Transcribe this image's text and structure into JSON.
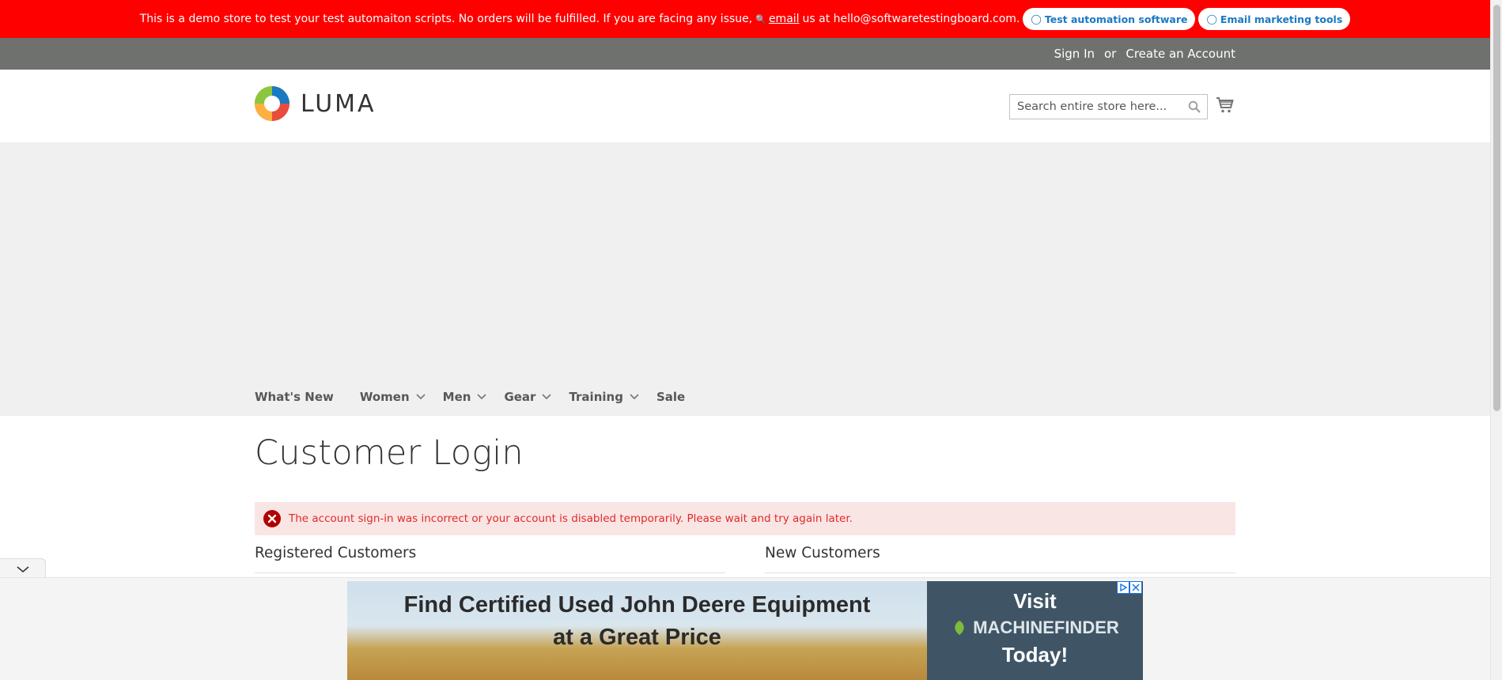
{
  "demo_banner": {
    "text": "This is a demo store to test your test automaiton scripts. No orders will be fulfilled. If you are facing any issue,",
    "email_link": "email",
    "text_after": "us at hello@softwaretestingboard.com.",
    "pill_1": "Test automation software",
    "pill_2": "Email marketing tools"
  },
  "panel": {
    "sign_in": "Sign In",
    "or": "or",
    "create_account": "Create an Account"
  },
  "header": {
    "logo_text": "LUMA",
    "search_placeholder": "Search entire store here..."
  },
  "nav": {
    "items": [
      {
        "label": "What's New"
      },
      {
        "label": "Women"
      },
      {
        "label": "Men"
      },
      {
        "label": "Gear"
      },
      {
        "label": "Training"
      },
      {
        "label": "Sale"
      }
    ]
  },
  "main": {
    "title": "Customer Login",
    "error_message": "The account sign-in was incorrect or your account is disabled temporarily. Please wait and try again later.",
    "registered_title": "Registered Customers",
    "new_title": "New Customers"
  },
  "ad": {
    "headline_1": "Find Certified Used John Deere Equipment",
    "headline_2": "at a Great Price",
    "visit": "Visit",
    "brand": "MACHINEFINDER",
    "today": "Today!"
  },
  "colors": {
    "demo_banner_bg": "#ff0000",
    "panel_bg": "#6e716e",
    "link_blue": "#1979c3",
    "error_text": "#e02b27",
    "error_bg": "#fae5e5"
  }
}
